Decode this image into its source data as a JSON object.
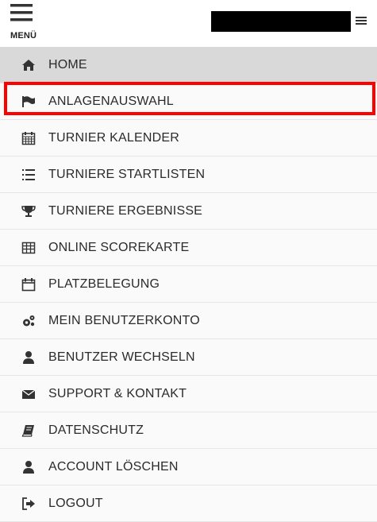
{
  "header": {
    "menu_label": "MENÜ",
    "menu_icon": "hamburger-icon",
    "secondary_menu_icon": "hamburger-small-icon"
  },
  "nav": {
    "items": [
      {
        "label": "HOME",
        "icon": "home-icon",
        "active": true
      },
      {
        "label": "ANLAGENAUSWAHL",
        "icon": "flag-icon",
        "highlighted": true
      },
      {
        "label": "TURNIER KALENDER",
        "icon": "calendar-icon"
      },
      {
        "label": "TURNIERE STARTLISTEN",
        "icon": "list-ordered-icon"
      },
      {
        "label": "TURNIERE ERGEBNISSE",
        "icon": "trophy-icon"
      },
      {
        "label": "ONLINE SCOREKARTE",
        "icon": "table-icon"
      },
      {
        "label": "PLATZBELEGUNG",
        "icon": "calendar-outline-icon"
      },
      {
        "label": "MEIN BENUTZERKONTO",
        "icon": "gears-icon"
      },
      {
        "label": "BENUTZER WECHSELN",
        "icon": "user-icon"
      },
      {
        "label": "SUPPORT & KONTAKT",
        "icon": "envelope-icon"
      },
      {
        "label": "DATENSCHUTZ",
        "icon": "book-icon"
      },
      {
        "label": "ACCOUNT LÖSCHEN",
        "icon": "user-icon"
      },
      {
        "label": "LOGOUT",
        "icon": "sign-out-icon"
      }
    ]
  },
  "colors": {
    "active_bg": "#d9d9d9",
    "highlight_border": "#ff0000",
    "text": "#2b2b2b"
  }
}
